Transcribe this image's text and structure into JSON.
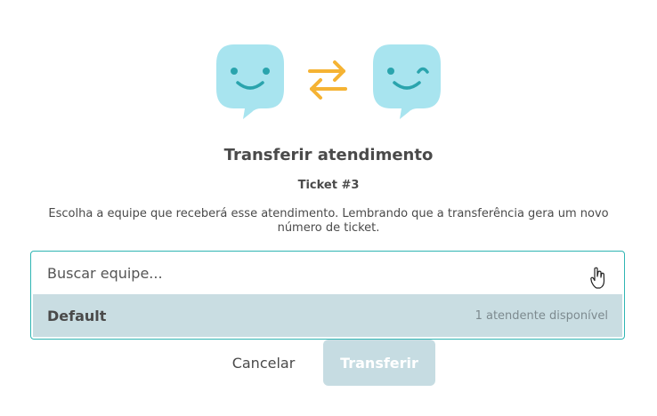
{
  "illustration": {
    "left_icon": "smiling-chat-bubble-icon",
    "middle_icon": "swap-arrows-icon",
    "right_icon": "winking-chat-bubble-icon",
    "bubble_color": "#a8e4ef",
    "face_color": "#2aa4ad",
    "arrow_color": "#f5b333"
  },
  "modal": {
    "title": "Transferir atendimento",
    "ticket": "Ticket #3",
    "description": "Escolha a equipe que receberá esse atendimento. Lembrando que a transferência gera um novo número de ticket."
  },
  "team_select": {
    "placeholder": "Buscar equipe...",
    "value": "",
    "options": [
      {
        "name": "Default",
        "meta": "1 atendente disponível"
      }
    ]
  },
  "actions": {
    "cancel_label": "Cancelar",
    "transfer_label": "Transferir"
  },
  "colors": {
    "accent_border": "#2fb5b3",
    "option_highlight": "#c9dde2",
    "transfer_disabled": "#c6dce2",
    "text": "#4a4a4a"
  }
}
